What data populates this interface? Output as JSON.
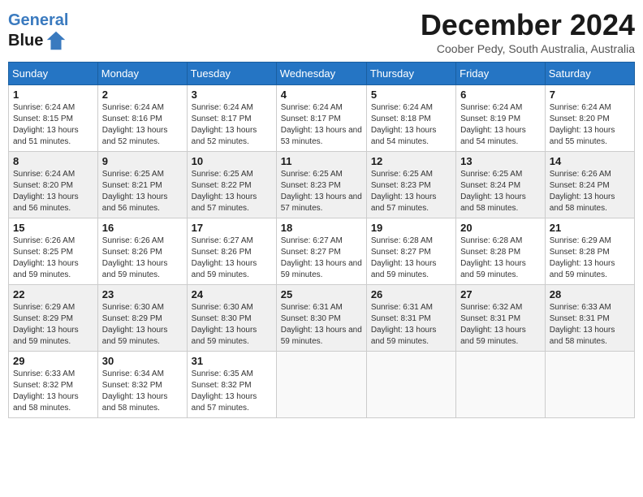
{
  "header": {
    "logo_line1": "General",
    "logo_line2": "Blue",
    "month_title": "December 2024",
    "subtitle": "Coober Pedy, South Australia, Australia"
  },
  "weekdays": [
    "Sunday",
    "Monday",
    "Tuesday",
    "Wednesday",
    "Thursday",
    "Friday",
    "Saturday"
  ],
  "weeks": [
    [
      {
        "day": "1",
        "sunrise": "6:24 AM",
        "sunset": "8:15 PM",
        "daylight": "13 hours and 51 minutes."
      },
      {
        "day": "2",
        "sunrise": "6:24 AM",
        "sunset": "8:16 PM",
        "daylight": "13 hours and 52 minutes."
      },
      {
        "day": "3",
        "sunrise": "6:24 AM",
        "sunset": "8:17 PM",
        "daylight": "13 hours and 52 minutes."
      },
      {
        "day": "4",
        "sunrise": "6:24 AM",
        "sunset": "8:17 PM",
        "daylight": "13 hours and 53 minutes."
      },
      {
        "day": "5",
        "sunrise": "6:24 AM",
        "sunset": "8:18 PM",
        "daylight": "13 hours and 54 minutes."
      },
      {
        "day": "6",
        "sunrise": "6:24 AM",
        "sunset": "8:19 PM",
        "daylight": "13 hours and 54 minutes."
      },
      {
        "day": "7",
        "sunrise": "6:24 AM",
        "sunset": "8:20 PM",
        "daylight": "13 hours and 55 minutes."
      }
    ],
    [
      {
        "day": "8",
        "sunrise": "6:24 AM",
        "sunset": "8:20 PM",
        "daylight": "13 hours and 56 minutes."
      },
      {
        "day": "9",
        "sunrise": "6:25 AM",
        "sunset": "8:21 PM",
        "daylight": "13 hours and 56 minutes."
      },
      {
        "day": "10",
        "sunrise": "6:25 AM",
        "sunset": "8:22 PM",
        "daylight": "13 hours and 57 minutes."
      },
      {
        "day": "11",
        "sunrise": "6:25 AM",
        "sunset": "8:23 PM",
        "daylight": "13 hours and 57 minutes."
      },
      {
        "day": "12",
        "sunrise": "6:25 AM",
        "sunset": "8:23 PM",
        "daylight": "13 hours and 57 minutes."
      },
      {
        "day": "13",
        "sunrise": "6:25 AM",
        "sunset": "8:24 PM",
        "daylight": "13 hours and 58 minutes."
      },
      {
        "day": "14",
        "sunrise": "6:26 AM",
        "sunset": "8:24 PM",
        "daylight": "13 hours and 58 minutes."
      }
    ],
    [
      {
        "day": "15",
        "sunrise": "6:26 AM",
        "sunset": "8:25 PM",
        "daylight": "13 hours and 59 minutes."
      },
      {
        "day": "16",
        "sunrise": "6:26 AM",
        "sunset": "8:26 PM",
        "daylight": "13 hours and 59 minutes."
      },
      {
        "day": "17",
        "sunrise": "6:27 AM",
        "sunset": "8:26 PM",
        "daylight": "13 hours and 59 minutes."
      },
      {
        "day": "18",
        "sunrise": "6:27 AM",
        "sunset": "8:27 PM",
        "daylight": "13 hours and 59 minutes."
      },
      {
        "day": "19",
        "sunrise": "6:28 AM",
        "sunset": "8:27 PM",
        "daylight": "13 hours and 59 minutes."
      },
      {
        "day": "20",
        "sunrise": "6:28 AM",
        "sunset": "8:28 PM",
        "daylight": "13 hours and 59 minutes."
      },
      {
        "day": "21",
        "sunrise": "6:29 AM",
        "sunset": "8:28 PM",
        "daylight": "13 hours and 59 minutes."
      }
    ],
    [
      {
        "day": "22",
        "sunrise": "6:29 AM",
        "sunset": "8:29 PM",
        "daylight": "13 hours and 59 minutes."
      },
      {
        "day": "23",
        "sunrise": "6:30 AM",
        "sunset": "8:29 PM",
        "daylight": "13 hours and 59 minutes."
      },
      {
        "day": "24",
        "sunrise": "6:30 AM",
        "sunset": "8:30 PM",
        "daylight": "13 hours and 59 minutes."
      },
      {
        "day": "25",
        "sunrise": "6:31 AM",
        "sunset": "8:30 PM",
        "daylight": "13 hours and 59 minutes."
      },
      {
        "day": "26",
        "sunrise": "6:31 AM",
        "sunset": "8:31 PM",
        "daylight": "13 hours and 59 minutes."
      },
      {
        "day": "27",
        "sunrise": "6:32 AM",
        "sunset": "8:31 PM",
        "daylight": "13 hours and 59 minutes."
      },
      {
        "day": "28",
        "sunrise": "6:33 AM",
        "sunset": "8:31 PM",
        "daylight": "13 hours and 58 minutes."
      }
    ],
    [
      {
        "day": "29",
        "sunrise": "6:33 AM",
        "sunset": "8:32 PM",
        "daylight": "13 hours and 58 minutes."
      },
      {
        "day": "30",
        "sunrise": "6:34 AM",
        "sunset": "8:32 PM",
        "daylight": "13 hours and 58 minutes."
      },
      {
        "day": "31",
        "sunrise": "6:35 AM",
        "sunset": "8:32 PM",
        "daylight": "13 hours and 57 minutes."
      },
      null,
      null,
      null,
      null
    ]
  ]
}
